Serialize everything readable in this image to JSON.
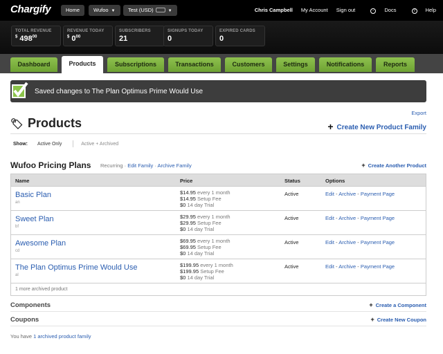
{
  "app": {
    "logo": "Chargify"
  },
  "topnav": {
    "home": "Home",
    "site": "Wufoo",
    "mode": "Test (USD)",
    "user": "Chris Campbell",
    "my_account": "My Account",
    "sign_out": "Sign out",
    "docs": "Docs",
    "help": "Help"
  },
  "stats": [
    {
      "label": "TOTAL REVENUE",
      "currency": "$",
      "value": "498",
      "cents": "00"
    },
    {
      "label": "REVENUE TODAY",
      "currency": "$",
      "value": "0",
      "cents": "00"
    },
    {
      "label": "SUBSCRIBERS",
      "currency": "",
      "value": "21",
      "cents": ""
    },
    {
      "label": "SIGNUPS TODAY",
      "currency": "",
      "value": "0",
      "cents": ""
    },
    {
      "label": "EXPIRED CARDS",
      "currency": "",
      "value": "0",
      "cents": ""
    }
  ],
  "tabs": [
    {
      "label": "Dashboard"
    },
    {
      "label": "Products"
    },
    {
      "label": "Subscriptions"
    },
    {
      "label": "Transactions"
    },
    {
      "label": "Customers"
    },
    {
      "label": "Settings"
    },
    {
      "label": "Notifications"
    },
    {
      "label": "Reports"
    }
  ],
  "active_tab": "Products",
  "flash": {
    "message": "Saved changes to The Plan Optimus Prime Would Use"
  },
  "page": {
    "export": "Export",
    "title": "Products",
    "create_family": "Create New Product Family",
    "show_label": "Show:",
    "show_active": "Active Only",
    "show_all": "Active + Archived"
  },
  "family": {
    "name": "Wufoo Pricing Plans",
    "type": "Recurring",
    "edit": "Edit Family",
    "archive": "Archive Family",
    "create_product": "Create Another Product",
    "headers": {
      "name": "Name",
      "price": "Price",
      "status": "Status",
      "options": "Options"
    },
    "products": [
      {
        "name": "Basic Plan",
        "handle": "an",
        "price": "$14.95",
        "interval": "every 1 month",
        "setup": "$14.95",
        "setup_note": "Setup Fee",
        "trial": "$0",
        "trial_note": "14 day Trial",
        "status": "Active"
      },
      {
        "name": "Sweet Plan",
        "handle": "bf",
        "price": "$29.95",
        "interval": "every 1 month",
        "setup": "$29.95",
        "setup_note": "Setup Fee",
        "trial": "$0",
        "trial_note": "14 day Trial",
        "status": "Active"
      },
      {
        "name": "Awesome Plan",
        "handle": "cd",
        "price": "$69.95",
        "interval": "every 1 month",
        "setup": "$69.95",
        "setup_note": "Setup Fee",
        "trial": "$0",
        "trial_note": "14 day Trial",
        "status": "Active"
      },
      {
        "name": "The Plan Optimus Prime Would Use",
        "handle": "al",
        "price": "$199.95",
        "interval": "every 1 month",
        "setup": "$199.95",
        "setup_note": "Setup Fee",
        "trial": "$0",
        "trial_note": "14 day Trial",
        "status": "Active"
      }
    ],
    "options": {
      "edit": "Edit",
      "archive": "Archive",
      "payment_page": "Payment Page"
    },
    "archived_note": "1 more archived product"
  },
  "components": {
    "title": "Components",
    "create": "Create a Component"
  },
  "coupons": {
    "title": "Coupons",
    "create": "Create New Coupon"
  },
  "footer": {
    "prefix": "You have",
    "link": "1 archived product family"
  }
}
